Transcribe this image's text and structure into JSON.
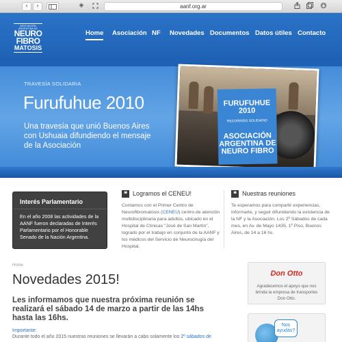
{
  "browser": {
    "back": "‹",
    "forward": "›",
    "sidebar_icon": "sidebar-icon",
    "shield_icon": "◈",
    "url": "aanf.org.ar",
    "share_icon": "share-icon",
    "tabs_icon": "tabs-icon",
    "download_icon": "download-icon"
  },
  "logo": {
    "line1": "ASOCIACIÓN",
    "line1b": "ARGENTINA DE",
    "line2": "NEURO",
    "line3": "FIBRO",
    "line4": "MATOSIS"
  },
  "nav": {
    "items": [
      {
        "label": "Home"
      },
      {
        "label": "Asociación"
      },
      {
        "label": "NF"
      },
      {
        "label": "Novedades"
      },
      {
        "label": "Documentos"
      },
      {
        "label": "Datos útiles"
      },
      {
        "label": "Contacto"
      }
    ]
  },
  "hero": {
    "kicker": "TRAVESÍA SOLIDARIA",
    "title": "Furufuhue 2010",
    "subtitle": "Una travesía que unió Buenos Aires con Ushuaia difundiendo el mensaje de la Asociación",
    "flag_title": "FURUFUHUE 2010",
    "flag_sub": "RECORRIDO SOLIDARIO",
    "flag_org": "ASOCIACIÓN ARGENTINA DE NEURO FIBRO"
  },
  "boxes": {
    "interes": {
      "title": "Interés Parlamentario",
      "text": "En el año 2008 las actividades de la AANF fueron declaradas de Interés Parlamentario por el Honorable Senado de la Nación Argentina."
    },
    "ceneu": {
      "title": "Logramos el CENEU!",
      "text_pre": "Contamos con el Primer Centro de Neurofibromatosis (",
      "link": "CENEU",
      "text_post": ") centro de atención multidisciplinaria para adultos, ubicado en el Hospital de Clínicas \"José de San Martín\", logrado por el trabajo en conjunto de la AANF y los médicos del Servicio de Neurocirugía del Hospital."
    },
    "reuniones": {
      "title": "Nuestras reuniones",
      "text": "Te esperamos para compartir experiencias, informarte, y seguir difundiendo la existencia de la NF y la Asociación. Los 2º Sábados de cada mes, en Av. de Mayo 1435, 1º Piso, Buenos Aires, de 14 a 16 hs."
    }
  },
  "main": {
    "breadcrumb": "Home",
    "title": "Novedades 2015!",
    "lead": "Les informamos que nuestra próxima reunión se realizará el sábado 14 de marzo a partir de las 14hs hasta las 16hs.",
    "important_label": "Importante:",
    "body_pre": "Durante todo el año 2015 nuestras reuniones se llevarán a cabo solamente los ",
    "body_link": "2º sábados de"
  },
  "sponsor": {
    "brand": "Don Otto",
    "text": "Agradecemos el apoyo que nos brinda la empresa de transportes Don Otto."
  },
  "help": {
    "bubble": "Nos ayudás?"
  }
}
